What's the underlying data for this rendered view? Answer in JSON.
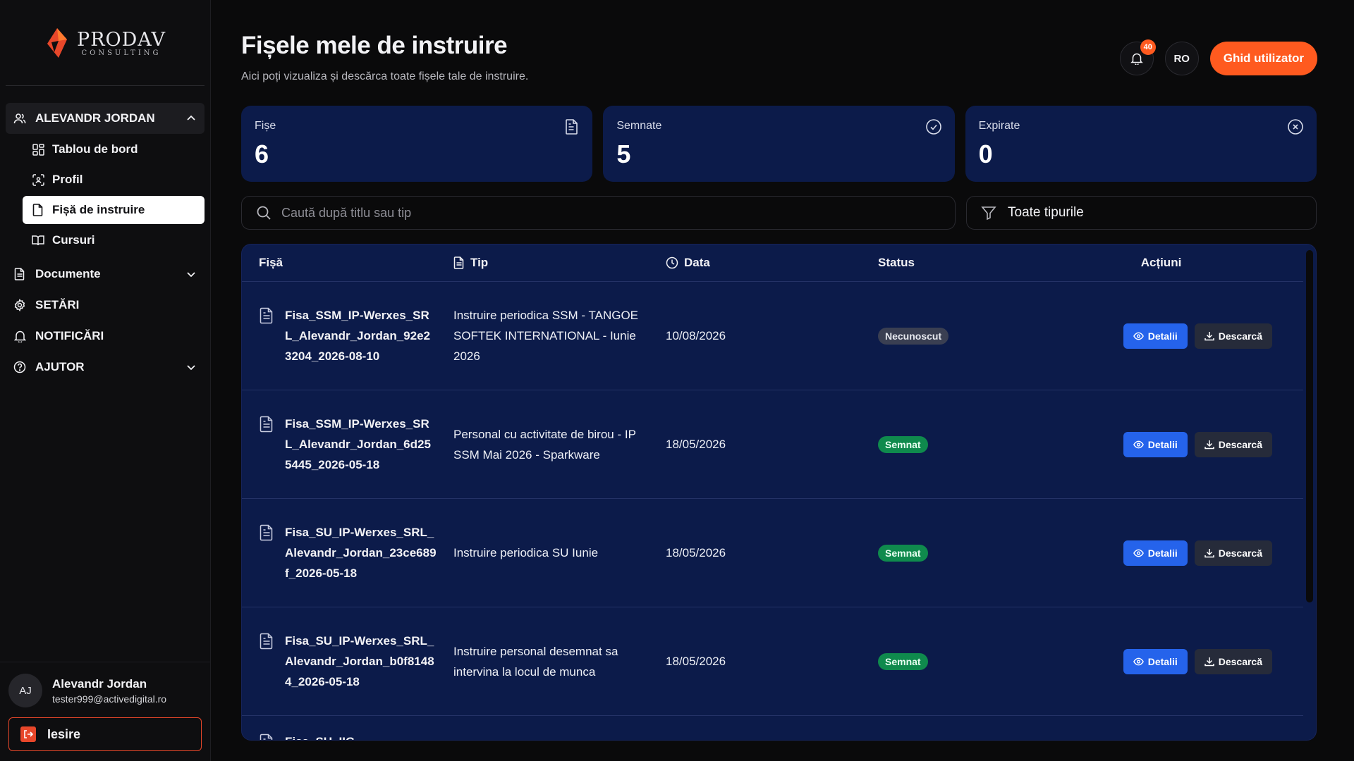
{
  "brand": {
    "name": "PRODAV",
    "tagline": "CONSULTING"
  },
  "sidebar": {
    "user_group": {
      "label": "ALEVANDR JORDAN"
    },
    "sub_items": [
      {
        "label": "Tablou de bord",
        "icon": "dashboard-icon"
      },
      {
        "label": "Profil",
        "icon": "profile-scan-icon"
      },
      {
        "label": "Fișă de instruire",
        "icon": "file-icon"
      },
      {
        "label": "Cursuri",
        "icon": "book-icon"
      }
    ],
    "groups": [
      {
        "label": "Documente",
        "icon": "document-icon"
      },
      {
        "label": "SETĂRI",
        "icon": "gear-icon"
      },
      {
        "label": "NOTIFICĂRI",
        "icon": "bell-icon"
      },
      {
        "label": "AJUTOR",
        "icon": "help-icon"
      }
    ],
    "footer": {
      "initials": "AJ",
      "name": "Alevandr Jordan",
      "email": "tester999@activedigital.ro",
      "logout_label": "Iesire"
    }
  },
  "header": {
    "title": "Fișele mele de instruire",
    "subtitle": "Aici poți vizualiza și descărca toate fișele tale de instruire.",
    "notifications_count": "40",
    "language": "RO",
    "guide_label": "Ghid utilizator"
  },
  "stats": [
    {
      "label": "Fișe",
      "value": "6",
      "icon": "document-icon"
    },
    {
      "label": "Semnate",
      "value": "5",
      "icon": "check-circle-icon"
    },
    {
      "label": "Expirate",
      "value": "0",
      "icon": "x-circle-icon"
    }
  ],
  "filters": {
    "search_placeholder": "Caută după titlu sau tip",
    "type_filter": "Toate tipurile"
  },
  "table": {
    "columns": {
      "file": "Fișă",
      "type": "Tip",
      "date": "Data",
      "status": "Status",
      "actions": "Acțiuni"
    },
    "rows": [
      {
        "file": "Fisa_SSM_IP-Werxes_SRL_Alevandr_Jordan_92e23204_2026-08-10",
        "type": "Instruire periodica SSM - TANGOE SOFTEK INTERNATIONAL - Iunie 2026",
        "date": "10/08/2026",
        "status": "Necunoscut"
      },
      {
        "file": "Fisa_SSM_IP-Werxes_SRL_Alevandr_Jordan_6d255445_2026-05-18",
        "type": "Personal cu activitate de birou - IP SSM Mai 2026 - Sparkware",
        "date": "18/05/2026",
        "status": "Semnat"
      },
      {
        "file": "Fisa_SU_IP-Werxes_SRL_Alevandr_Jordan_23ce689f_2026-05-18",
        "type": "Instruire periodica SU Iunie",
        "date": "18/05/2026",
        "status": "Semnat"
      },
      {
        "file": "Fisa_SU_IP-Werxes_SRL_Alevandr_Jordan_b0f81484_2026-05-18",
        "type": "Instruire personal desemnat sa intervina la locul de munca",
        "date": "18/05/2026",
        "status": "Semnat"
      },
      {
        "file": "Fisa_SU_IIG-",
        "type": "",
        "date": "",
        "status": ""
      }
    ],
    "details_label": "Detalii",
    "download_label": "Descarcă"
  },
  "colors": {
    "accent": "#ff5a1f",
    "card": "#0c1b4a",
    "primary_button": "#2563eb",
    "signed": "#0f8a4d"
  }
}
